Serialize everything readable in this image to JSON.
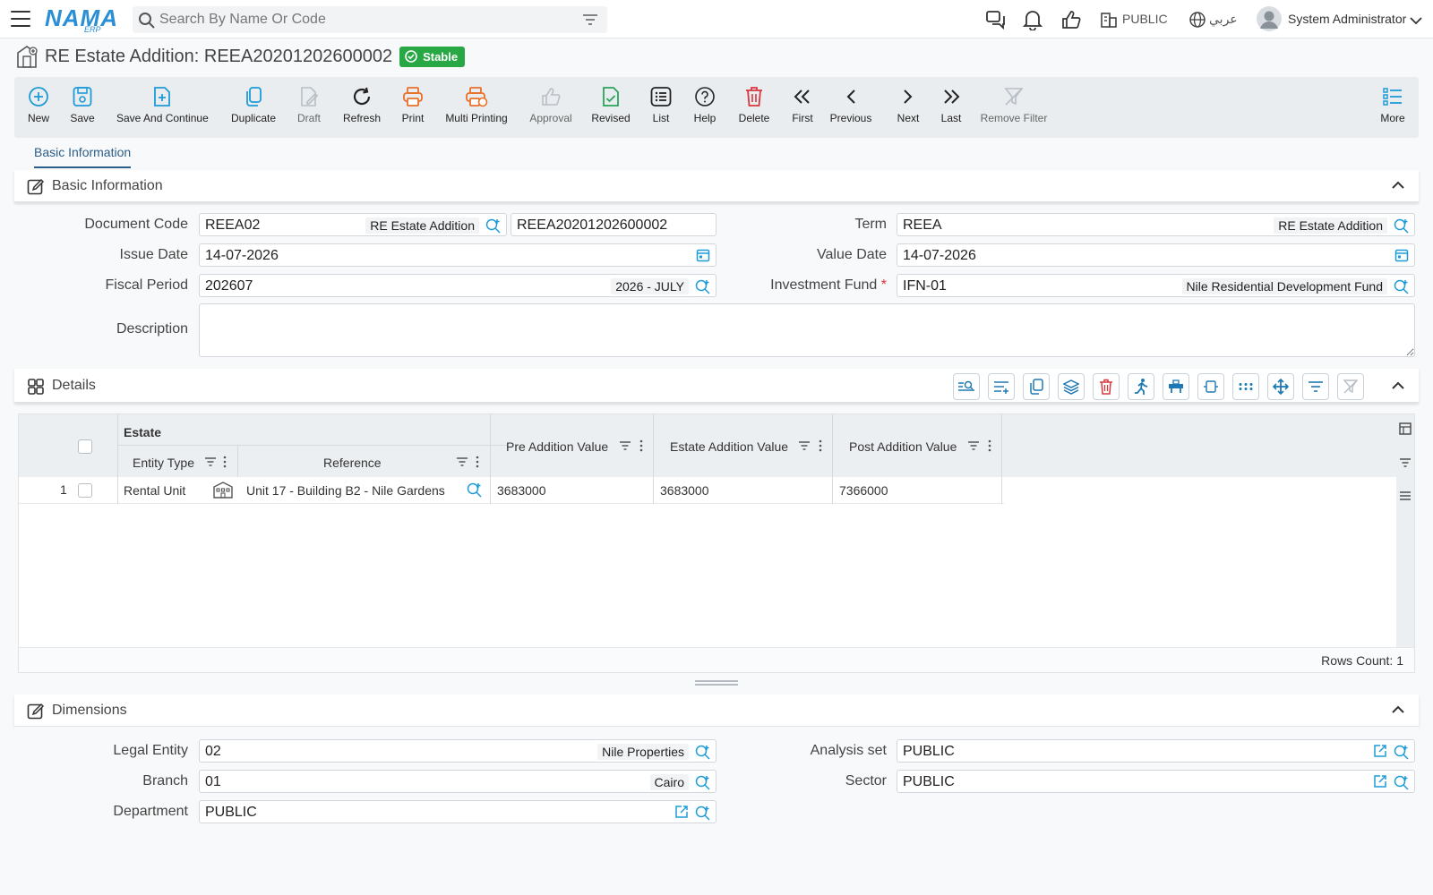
{
  "topbar": {
    "logo_main": "NAMA",
    "logo_sub": "ERP",
    "search_placeholder": "Search By Name Or Code",
    "company": "PUBLIC",
    "language": "عربي",
    "user": "System Administrator"
  },
  "page": {
    "title": "RE Estate Addition: REEA20201202600002",
    "status": "Stable"
  },
  "toolbar": {
    "new": "New",
    "save": "Save",
    "save_continue": "Save And Continue",
    "duplicate": "Duplicate",
    "draft": "Draft",
    "refresh": "Refresh",
    "print": "Print",
    "multi_printing": "Multi Printing",
    "approval": "Approval",
    "revised": "Revised",
    "list": "List",
    "help": "Help",
    "delete": "Delete",
    "first": "First",
    "previous": "Previous",
    "next": "Next",
    "last": "Last",
    "remove_filter": "Remove Filter",
    "more": "More"
  },
  "tabs": {
    "basic": "Basic Information"
  },
  "basic": {
    "section_title": "Basic Information",
    "document_code_label": "Document Code",
    "document_code": "REEA02",
    "document_code_desc": "RE Estate Addition",
    "document_number": "REEA20201202600002",
    "term_label": "Term",
    "term": "REEA",
    "term_desc": "RE Estate Addition",
    "issue_date_label": "Issue Date",
    "issue_date": "14-07-2026",
    "value_date_label": "Value Date",
    "value_date": "14-07-2026",
    "fiscal_period_label": "Fiscal Period",
    "fiscal_period": "202607",
    "fiscal_period_desc": "2026 - JULY",
    "investment_fund_label": "Investment Fund",
    "required_mark": "*",
    "investment_fund": "IFN-01",
    "investment_fund_desc": "Nile Residential Development Fund",
    "description_label": "Description"
  },
  "details": {
    "section_title": "Details",
    "group_header": "Estate",
    "columns": {
      "entity_type": "Entity Type",
      "reference": "Reference",
      "pre_addition": "Pre Addition Value",
      "estate_addition": "Estate Addition Value",
      "post_addition": "Post Addition Value"
    },
    "rows": [
      {
        "num": "1",
        "entity_type": "Rental Unit",
        "reference": "Unit 17 - Building B2 - Nile Gardens",
        "pre_addition": "3683000",
        "estate_addition": "3683000",
        "post_addition": "7366000"
      }
    ],
    "rows_count": "Rows Count: 1"
  },
  "dimensions": {
    "section_title": "Dimensions",
    "legal_entity_label": "Legal Entity",
    "legal_entity": "02",
    "legal_entity_desc": "Nile Properties",
    "analysis_set_label": "Analysis set",
    "analysis_set": "PUBLIC",
    "branch_label": "Branch",
    "branch": "01",
    "branch_desc": "Cairo",
    "sector_label": "Sector",
    "sector": "PUBLIC",
    "department_label": "Department",
    "department": "PUBLIC"
  },
  "colors": {
    "brand": "#2a8fd4",
    "accent": "#1e9bd7",
    "stable_badge": "#28a745",
    "delete": "#d9363e",
    "print": "#e8702a"
  }
}
